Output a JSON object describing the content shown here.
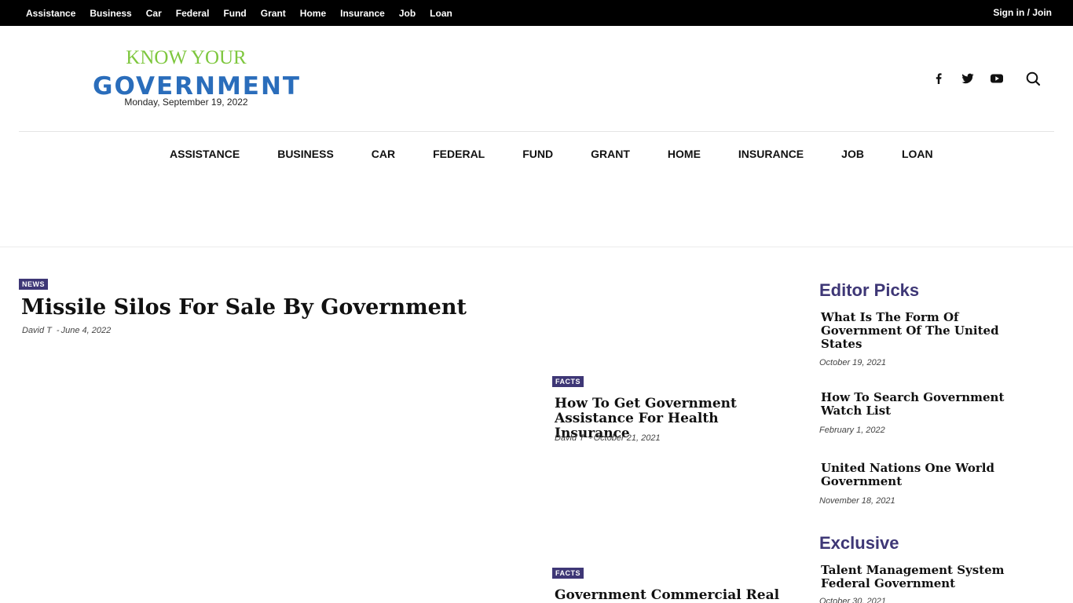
{
  "topbar": {
    "menu": [
      "Assistance",
      "Business",
      "Car",
      "Federal",
      "Fund",
      "Grant",
      "Home",
      "Insurance",
      "Job",
      "Loan"
    ],
    "signin_label": "Sign in / Join"
  },
  "header": {
    "logo_top": "KNOW YOUR",
    "logo_main": "GOVERNMENT",
    "date": "Monday, September 19, 2022",
    "social_icons": [
      "facebook-icon",
      "twitter-icon",
      "youtube-icon",
      "search-icon"
    ]
  },
  "main_menu": [
    "ASSISTANCE",
    "BUSINESS",
    "CAR",
    "FEDERAL",
    "FUND",
    "GRANT",
    "HOME",
    "INSURANCE",
    "JOB",
    "LOAN"
  ],
  "featured": {
    "category": "NEWS",
    "title": "Missile Silos For Sale By Government",
    "author": "David T",
    "date": "June 4, 2022"
  },
  "cards": [
    {
      "category": "FACTS",
      "title": "How To Get Government Assistance For Health Insurance",
      "author": "David T",
      "date": "October 21, 2021"
    },
    {
      "category": "FACTS",
      "title": "Government Commercial Real"
    }
  ],
  "sidebar": {
    "editor_heading": "Editor Picks",
    "editor_picks": [
      {
        "title": "What Is The Form Of Government Of The United States",
        "date": "October 19, 2021"
      },
      {
        "title": "How To Search Government Watch List",
        "date": "February 1, 2022"
      },
      {
        "title": "United Nations One World Government",
        "date": "November 18, 2021"
      }
    ],
    "exclusive_heading": "Exclusive",
    "exclusive": [
      {
        "title": "Talent Management System Federal Government",
        "date": "October 30, 2021"
      }
    ]
  },
  "colors": {
    "topbar_bg": "#000000",
    "logo_green": "#7ec73e",
    "logo_blue": "#2a6dbb",
    "accent_purple": "#3e3776"
  }
}
